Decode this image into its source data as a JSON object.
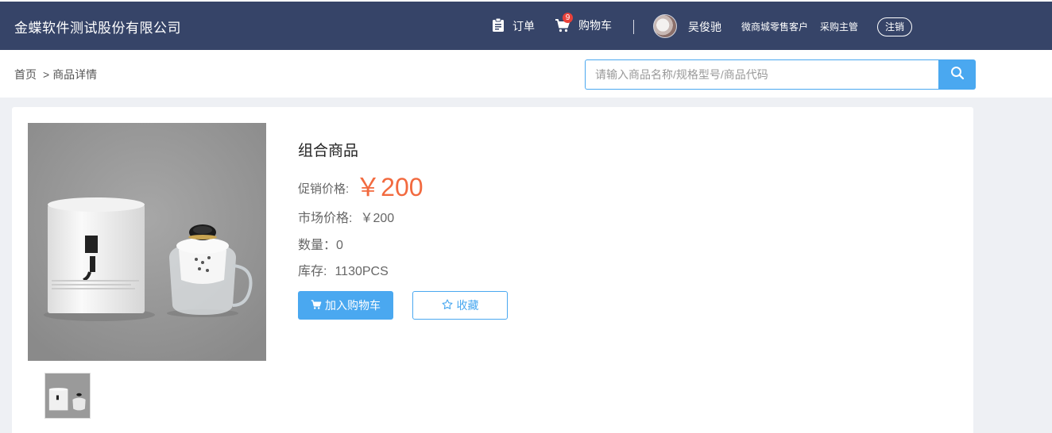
{
  "header": {
    "company": "金蝶软件测试股份有限公司",
    "orders_label": "订单",
    "cart_label": "购物车",
    "cart_count": "9",
    "user_name": "吴俊驰",
    "user_tags": [
      "微商城零售客户",
      "采购主管"
    ],
    "logout_label": "注销"
  },
  "breadcrumb": {
    "home": "首页",
    "separator": ">",
    "current": "商品详情"
  },
  "search": {
    "placeholder": "请输入商品名称/规格型号/商品代码",
    "value": ""
  },
  "product": {
    "name": "组合商品",
    "promo_label": "促销价格:",
    "promo_price": "￥200",
    "market_label": "市场价格:",
    "market_price": "￥200",
    "qty_label": "数量：",
    "qty_value": "0",
    "stock_label": "库存:",
    "stock_value": "1130PCS",
    "add_cart_label": "加入购物车",
    "favorite_label": "收藏",
    "image_alt": "product-image-tea-cup-set"
  },
  "colors": {
    "header_bg": "#364468",
    "accent": "#4aa8f0",
    "price": "#f26a3f",
    "badge": "#e8413a"
  },
  "icons": [
    "clipboard-icon",
    "cart-icon",
    "search-icon",
    "star-icon"
  ]
}
